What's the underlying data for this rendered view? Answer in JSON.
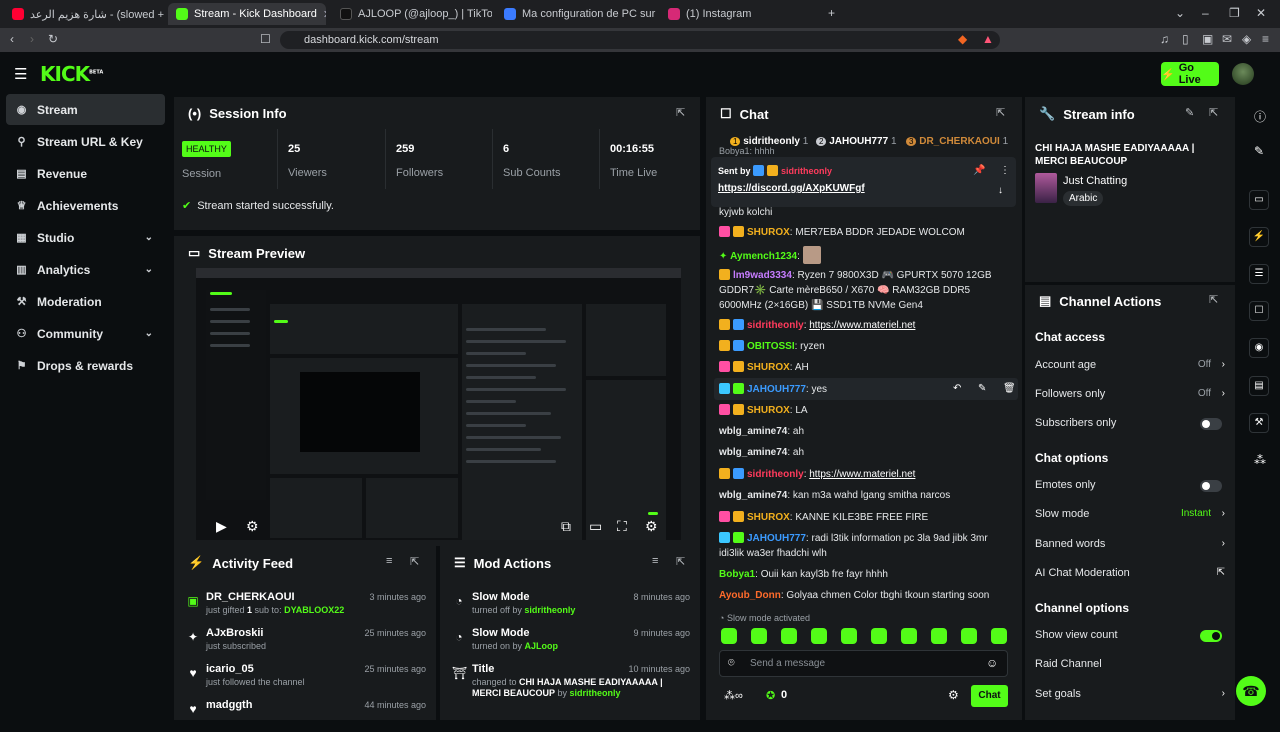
{
  "browser": {
    "tabs": [
      {
        "title": "شارة هزيم الرعد - (slowed + reverb)",
        "color": "#ff0033"
      },
      {
        "title": "Stream - Kick Dashboard",
        "color": "#53fc18"
      },
      {
        "title": "AJLOOP (@ajloop_) | TikTok",
        "color": "#111111"
      },
      {
        "title": "Ma configuration de PC sur mesure a",
        "color": "#3b7bff"
      },
      {
        "title": "(1) Instagram",
        "color": "#d62976"
      }
    ],
    "url": "dashboard.kick.com/stream"
  },
  "header": {
    "logo": "KICK",
    "logo_sup": "BETA",
    "go_live": "Go Live"
  },
  "sidebar": {
    "items": [
      {
        "label": "Stream",
        "icon": "broadcast-icon"
      },
      {
        "label": "Stream URL & Key",
        "icon": "link-icon"
      },
      {
        "label": "Revenue",
        "icon": "chart-icon"
      },
      {
        "label": "Achievements",
        "icon": "trophy-icon"
      },
      {
        "label": "Studio",
        "icon": "studio-icon"
      },
      {
        "label": "Analytics",
        "icon": "analytics-icon"
      },
      {
        "label": "Moderation",
        "icon": "hammer-icon"
      },
      {
        "label": "Community",
        "icon": "people-icon"
      },
      {
        "label": "Drops & rewards",
        "icon": "gift-icon"
      }
    ]
  },
  "session": {
    "title": "Session Info",
    "health": "HEALTHY",
    "session_label": "Session",
    "stats": [
      {
        "value": "25",
        "label": "Viewers"
      },
      {
        "value": "259",
        "label": "Followers"
      },
      {
        "value": "6",
        "label": "Sub Counts"
      },
      {
        "value": "00:16:55",
        "label": "Time Live"
      }
    ],
    "status": "Stream started successfully."
  },
  "preview": {
    "title": "Stream Preview"
  },
  "activity": {
    "title": "Activity Feed",
    "rows": [
      {
        "name": "DR_CHERKAOUI",
        "text_a": "just gifted ",
        "count": "1",
        "text_b": " sub to: ",
        "target": "DYABLOOX22",
        "time": "3 minutes ago"
      },
      {
        "name": "AJxBroskii",
        "text_a": "just subscribed",
        "count": "",
        "text_b": "",
        "target": "",
        "time": "25 minutes ago"
      },
      {
        "name": "icario_05",
        "text_a": "just followed the channel",
        "count": "",
        "text_b": "",
        "target": "",
        "time": "25 minutes ago"
      },
      {
        "name": "madggth",
        "text_a": "",
        "count": "",
        "text_b": "",
        "target": "",
        "time": "44 minutes ago"
      }
    ]
  },
  "mod": {
    "title": "Mod Actions",
    "rows": [
      {
        "name": "Slow Mode",
        "text": "turned off by ",
        "by": "sidritheonly",
        "time": "8 minutes ago"
      },
      {
        "name": "Slow Mode",
        "text": "turned on by ",
        "by": "AJLoop",
        "time": "9 minutes ago"
      },
      {
        "name": "Title",
        "text": "changed to ",
        "title_value": "CHI HAJA MASHE EADIYAAAAA | MERCI BEAUCOUP",
        "by_text": " by ",
        "by": "sidritheonly",
        "time": "10 minutes ago"
      }
    ]
  },
  "chat": {
    "title": "Chat",
    "top_gifters": [
      {
        "rank": "1",
        "name": "sidritheonly",
        "count": "1",
        "color": "#f2b01e"
      },
      {
        "rank": "2",
        "name": "JAHOUH777",
        "count": "1",
        "color": "#c9ccd1"
      },
      {
        "rank": "3",
        "name": "DR_CHERKAOUI",
        "count": "1",
        "color": "#d08a3a"
      }
    ],
    "pinned": {
      "prefix": "Sent by",
      "user": "sidritheonly",
      "link": "https://discord.gg/AXpKUWFgf",
      "partial_above": "Bobya1: hhhh"
    },
    "messages": [
      {
        "user": "",
        "text": "kyjwb kolchi",
        "color": "#e6e8ea"
      },
      {
        "user": "SHUROX",
        "text": "MER7EBA BDDR JEDADE WOLCOM",
        "color": "#f2b01e"
      },
      {
        "user": "Aymench1234",
        "text": "",
        "color": "#53fc18"
      },
      {
        "user": "lm9wad3334",
        "text": "Ryzen 7 9800X3D 🎮 GPURTX 5070 12GB GDDR7✳️ Carte mèreB650 / X670 🧠 RAM32GB DDR5 6000MHz (2×16GB) 💾 SSD1TB NVMe Gen4",
        "color": "#c67cff"
      },
      {
        "user": "sidritheonly",
        "text": "https://www.materiel.net",
        "color": "#ff3b5c"
      },
      {
        "user": "OBITOSSI",
        "text": "ryzen",
        "color": "#53fc18"
      },
      {
        "user": "SHUROX",
        "text": "AH",
        "color": "#f2b01e"
      },
      {
        "user": "JAHOUH777",
        "text": "yes",
        "color": "#3b9bff"
      },
      {
        "user": "SHUROX",
        "text": "LA",
        "color": "#f2b01e"
      },
      {
        "user": "wblg_amine74",
        "text": "ah",
        "color": "#e6e8ea"
      },
      {
        "user": "wblg_amine74",
        "text": "ah",
        "color": "#e6e8ea"
      },
      {
        "user": "sidritheonly",
        "text": "https://www.materiel.net",
        "color": "#ff3b5c"
      },
      {
        "user": "wblg_amine74",
        "text": "kan m3a wahd lgang smitha narcos",
        "color": "#e6e8ea"
      },
      {
        "user": "SHUROX",
        "text": "KANNE KILE3BE FREE FIRE",
        "color": "#f2b01e"
      },
      {
        "user": "JAHOUH777",
        "text": "radi l3tik information pc 3la 9ad jibk 3mr idi3lik wa3er fhadchi wlh",
        "color": "#3b9bff"
      },
      {
        "user": "Bobya1",
        "text": "Ouii kan kayl3b fre fayr hhhh",
        "color": "#53fc18"
      },
      {
        "user": "Ayoub_Donn",
        "text": "Golyaa chmen Color tbghi tkoun starting soon",
        "color": "#ff6b2b"
      }
    ],
    "slow_mode_notice": "Slow mode activated",
    "input_placeholder": "Send a message",
    "points": "0",
    "send_label": "Chat"
  },
  "stream_info": {
    "title": "Stream info",
    "stream_title": "CHI HAJA MASHE EADIYAAAAA | MERCI BEAUCOUP",
    "category": "Just Chatting",
    "tag": "Arabic"
  },
  "channel_actions": {
    "title": "Channel Actions",
    "chat_access_heading": "Chat access",
    "chat_access": [
      {
        "label": "Account age",
        "value": "Off"
      },
      {
        "label": "Followers only",
        "value": "Off"
      },
      {
        "label": "Subscribers only",
        "value": ""
      }
    ],
    "chat_options_heading": "Chat options",
    "chat_options": [
      {
        "label": "Emotes only",
        "value": ""
      },
      {
        "label": "Slow mode",
        "value": "Instant"
      },
      {
        "label": "Banned words",
        "value": ""
      },
      {
        "label": "AI Chat Moderation",
        "value": ""
      }
    ],
    "channel_options_heading": "Channel options",
    "channel_options": [
      {
        "label": "Show view count",
        "value": ""
      },
      {
        "label": "Raid Channel",
        "value": ""
      },
      {
        "label": "Set goals",
        "value": ""
      }
    ]
  },
  "colors": {
    "accent": "#53fc18",
    "panel": "#181b1d",
    "bg": "#0b0e10"
  }
}
